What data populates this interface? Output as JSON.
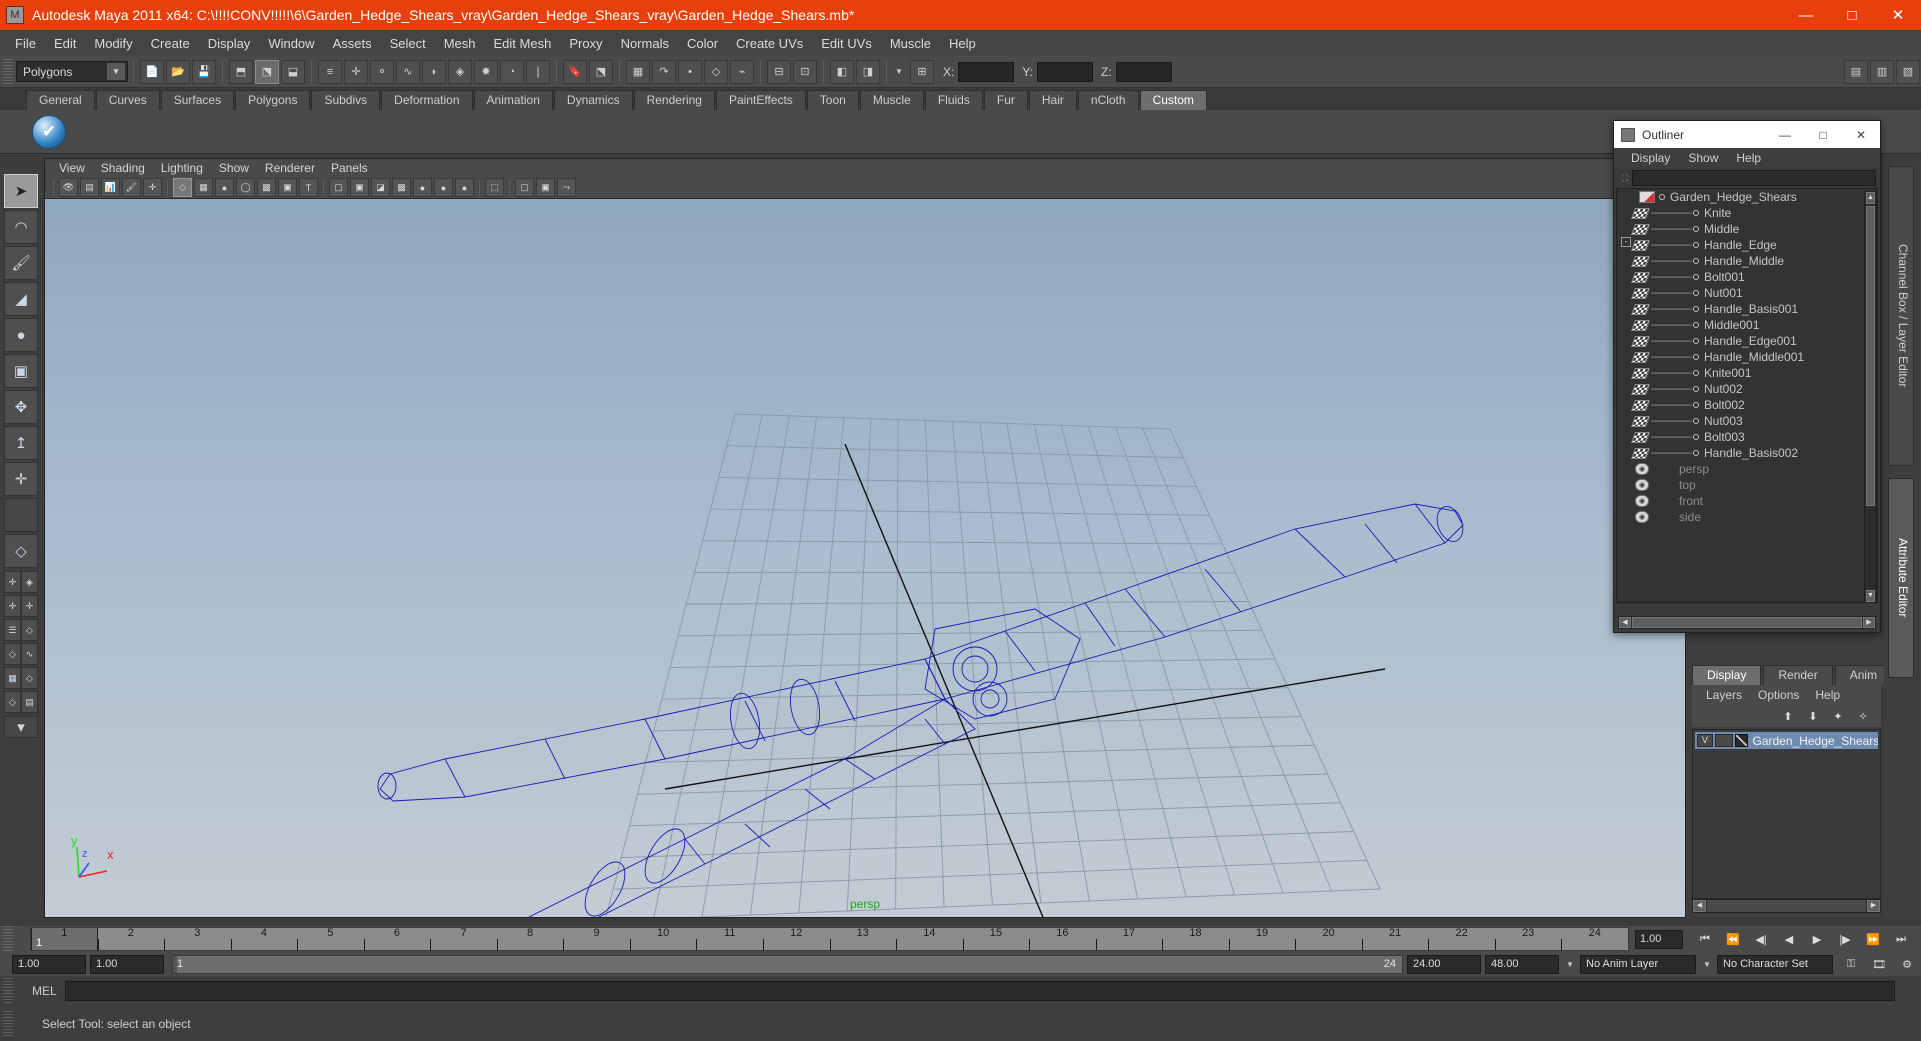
{
  "window": {
    "title": "Autodesk Maya 2011 x64: C:\\!!!!CONV!!!!!\\6\\Garden_Hedge_Shears_vray\\Garden_Hedge_Shears_vray\\Garden_Hedge_Shears.mb*",
    "app_icon": "maya-icon",
    "minimize": "—",
    "maximize": "□",
    "close": "✕",
    "titlebar_color": "#e8400c"
  },
  "menubar": {
    "items": [
      "File",
      "Edit",
      "Modify",
      "Create",
      "Display",
      "Window",
      "Assets",
      "Select",
      "Mesh",
      "Edit Mesh",
      "Proxy",
      "Normals",
      "Color",
      "Create UVs",
      "Edit UVs",
      "Muscle",
      "Help"
    ]
  },
  "statusline": {
    "mode_selector": "Polygons",
    "coord_labels": [
      "X:",
      "Y:",
      "Z:"
    ],
    "coord_values": [
      "",
      "",
      ""
    ]
  },
  "shelf": {
    "tabs": [
      "General",
      "Curves",
      "Surfaces",
      "Polygons",
      "Subdivs",
      "Deformation",
      "Animation",
      "Dynamics",
      "Rendering",
      "PaintEffects",
      "Toon",
      "Muscle",
      "Fluids",
      "Fur",
      "Hair",
      "nCloth",
      "Custom"
    ],
    "active_tab": "Custom",
    "icons": [
      "shelf-item-checkmark"
    ]
  },
  "toolbox": {
    "items": [
      {
        "name": "select-tool",
        "glyph": "➤",
        "selected": true
      },
      {
        "name": "lasso-select-tool",
        "glyph": "➤"
      },
      {
        "name": "paint-select-tool",
        "glyph": "✎"
      },
      {
        "name": "move-tool",
        "glyph": "◢"
      },
      {
        "name": "rotate-tool",
        "glyph": "●"
      },
      {
        "name": "scale-tool",
        "glyph": "▣"
      },
      {
        "name": "universal-manipulator-tool",
        "glyph": "✣"
      },
      {
        "name": "soft-modification-tool",
        "glyph": "↑"
      },
      {
        "name": "show-manipulator-tool",
        "glyph": "⊕"
      },
      {
        "name": "last-tool-used",
        "glyph": ""
      }
    ],
    "layout_items": [
      "single-perspective-view",
      "four-view-layout",
      "two-pane-split",
      "outliner-persp-layout",
      "persp-graph-layout",
      "hypershade-persp-layout",
      "persp-graph-outliner-layout"
    ]
  },
  "viewport": {
    "menu": [
      "View",
      "Shading",
      "Lighting",
      "Show",
      "Renderer",
      "Panels"
    ],
    "camera_label": "persp",
    "axis": {
      "x": "x",
      "y": "y",
      "z": "z",
      "x_color": "#ee2222",
      "y_color": "#22dd22",
      "z_color": "#3355ee"
    },
    "toolbar_icons": [
      "select-camera-icon",
      "camera-attributes-icon",
      "bookmark-icon",
      "image-plane-icon",
      "keyframe-icon",
      "wireframe-icon",
      "smooth-shade-icon",
      "shaded-sphere-icon",
      "flat-shade-icon",
      "wireframe-on-shaded-icon",
      "texture-icon",
      "text-icon",
      "xray-icon",
      "xray-joints-icon",
      "shadows-icon",
      "checker-icon",
      "light-yellow-icon",
      "light-grey-icon",
      "light-amber-icon",
      "isolate-select-icon",
      "bounding-box-icon",
      "panel-layout-icon",
      "share-icon"
    ],
    "grid_color": "#7a889a",
    "wire_color": "#1e1ea0",
    "bg_top": "#8fa7bf",
    "bg_bottom": "#c3ccd4"
  },
  "outliner": {
    "title": "Outliner",
    "minimize": "—",
    "maximize": "□",
    "close": "✕",
    "menu": [
      "Display",
      "Show",
      "Help"
    ],
    "search_value": "",
    "root": {
      "label": "Garden_Hedge_Shears",
      "expander": "-"
    },
    "items": [
      "Knite",
      "Middle",
      "Handle_Edge",
      "Handle_Middle",
      "Bolt001",
      "Nut001",
      "Handle_Basis001",
      "Middle001",
      "Handle_Edge001",
      "Handle_Middle001",
      "Knite001",
      "Nut002",
      "Bolt002",
      "Nut003",
      "Bolt003",
      "Handle_Basis002"
    ],
    "cameras": [
      "persp",
      "top",
      "front",
      "side"
    ]
  },
  "rightdock": {
    "tabs": [
      "Display",
      "Render",
      "Anim"
    ],
    "active_tab": "Display",
    "layer_menu": [
      "Layers",
      "Options",
      "Help"
    ],
    "layer_tools": [
      "move-layer-up-icon",
      "move-layer-down-icon",
      "new-layer-icon",
      "new-layer-from-selected-icon"
    ],
    "layers": [
      {
        "visibility": "V",
        "playback": "",
        "name": "Garden_Hedge_Shears_l"
      }
    ],
    "side_tabs": [
      "Channel Box / Layer Editor",
      "Attribute Editor"
    ],
    "side_tab_active": "Attribute Editor"
  },
  "timeline": {
    "ticks": [
      1,
      2,
      3,
      4,
      5,
      6,
      7,
      8,
      9,
      10,
      11,
      12,
      13,
      14,
      15,
      16,
      17,
      18,
      19,
      20,
      21,
      22,
      23,
      24
    ],
    "current_frame": "1",
    "current_frame_field": "1.00",
    "playback_buttons": [
      "go-to-start-icon",
      "step-back-keyframe-icon",
      "step-back-frame-icon",
      "play-backwards-icon",
      "play-forwards-icon",
      "step-forward-frame-icon",
      "step-forward-keyframe-icon",
      "go-to-end-icon"
    ]
  },
  "rangebar": {
    "anim_start": "1.00",
    "range_start": "1.00",
    "slider_start": "1",
    "slider_end": "24",
    "range_end": "24.00",
    "anim_end": "48.00",
    "anim_layer": "No Anim Layer",
    "character_set": "No Character Set",
    "key_icon": "key-icon",
    "auto_key_icon": "auto-keyframe-icon"
  },
  "command": {
    "label": "MEL",
    "value": ""
  },
  "helpline": {
    "text": "Select Tool: select an object"
  }
}
